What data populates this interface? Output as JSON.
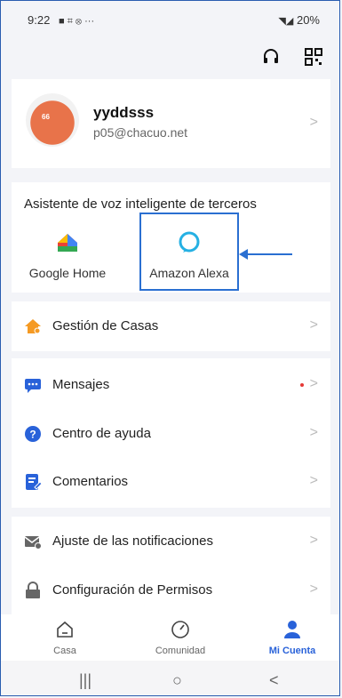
{
  "status": {
    "time": "9:22",
    "left_icons": "■ ⌗ ⊗ ···",
    "right": "20%"
  },
  "profile": {
    "name": "yyddsss",
    "email": "p05@chacuo.net",
    "avatar_text": "66"
  },
  "voice": {
    "title": "Asistente de voz inteligente de terceros",
    "items": [
      {
        "label": "Google Home",
        "icon": "google-home-icon"
      },
      {
        "label": "Amazon Alexa",
        "icon": "alexa-icon"
      }
    ]
  },
  "menu": {
    "homes": "Gestión de Casas",
    "messages": "Mensajes",
    "help": "Centro de ayuda",
    "feedback": "Comentarios",
    "notifications": "Ajuste de las notificaciones",
    "permissions": "Configuración de Permisos"
  },
  "tabs": [
    {
      "label": "Casa",
      "icon": "house-icon"
    },
    {
      "label": "Comunidad",
      "icon": "compass-icon"
    },
    {
      "label": "Mi Cuenta",
      "icon": "user-icon"
    }
  ],
  "nav": {
    "recent": "|||",
    "home": "○",
    "back": "<"
  },
  "colors": {
    "accent": "#2962d9",
    "annotation": "#2a6fd1"
  }
}
